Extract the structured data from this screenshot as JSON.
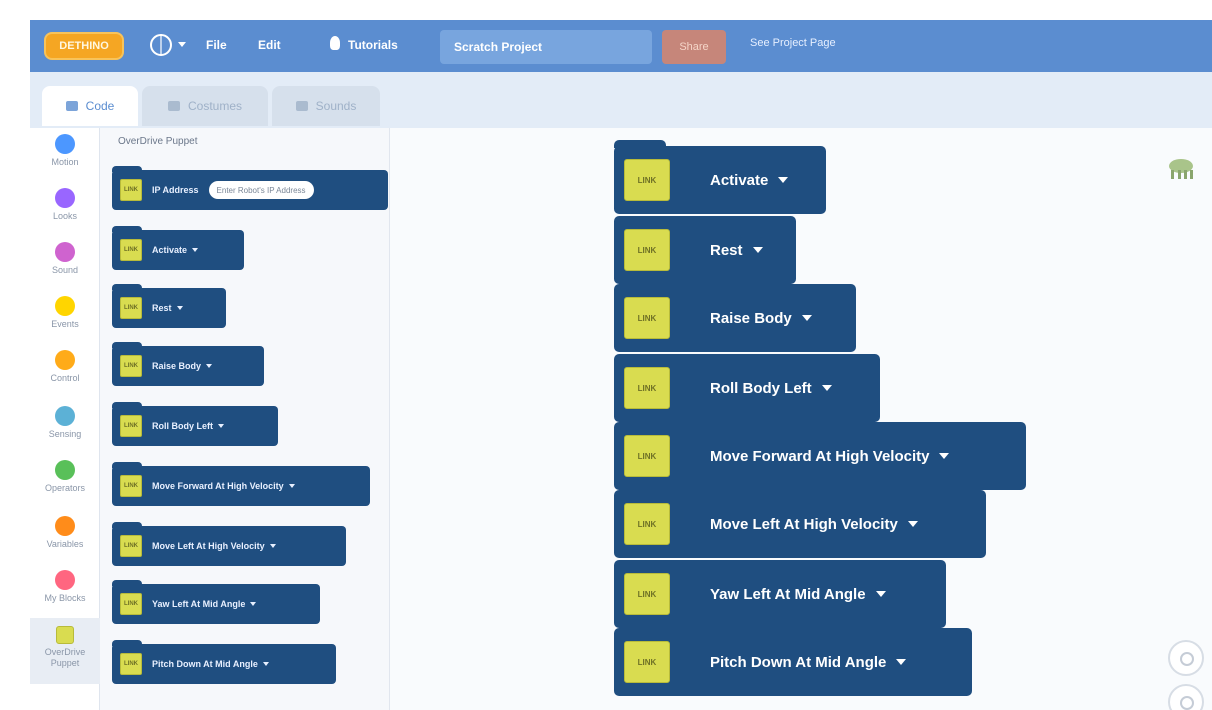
{
  "menubar": {
    "logo": "DETHINO",
    "file_label": "File",
    "edit_label": "Edit",
    "tutorials_label": "Tutorials",
    "project_title": "Scratch Project",
    "share_label": "Share",
    "see_project_label": "See Project Page"
  },
  "tabs": {
    "code": "Code",
    "costumes": "Costumes",
    "sounds": "Sounds"
  },
  "categories": [
    {
      "label": "Motion",
      "color": "#4c97ff"
    },
    {
      "label": "Looks",
      "color": "#9966ff"
    },
    {
      "label": "Sound",
      "color": "#cf63cf"
    },
    {
      "label": "Events",
      "color": "#ffd500"
    },
    {
      "label": "Control",
      "color": "#ffab19"
    },
    {
      "label": "Sensing",
      "color": "#5cb1d6"
    },
    {
      "label": "Operators",
      "color": "#59c059"
    },
    {
      "label": "Variables",
      "color": "#ff8c1a"
    },
    {
      "label": "My Blocks",
      "color": "#ff6680"
    },
    {
      "label": "OverDrive Puppet",
      "color": "#d9dc50"
    }
  ],
  "palette": {
    "title": "OverDrive Puppet",
    "block_icon_text": "LINK",
    "blocks": [
      {
        "label": "IP Address",
        "input_placeholder": "Enter Robot's IP Address"
      },
      {
        "label": "Activate"
      },
      {
        "label": "Rest"
      },
      {
        "label": "Raise Body"
      },
      {
        "label": "Roll Body Left"
      },
      {
        "label": "Move Forward At High Velocity"
      },
      {
        "label": "Move Left At High Velocity"
      },
      {
        "label": "Yaw Left At Mid Angle"
      },
      {
        "label": "Pitch Down At Mid Angle"
      }
    ]
  },
  "script": {
    "block_icon_text": "LINK",
    "blocks": [
      {
        "label": "Activate"
      },
      {
        "label": "Rest"
      },
      {
        "label": "Raise Body"
      },
      {
        "label": "Roll Body Left"
      },
      {
        "label": "Move Forward At High Velocity"
      },
      {
        "label": "Move Left At High Velocity"
      },
      {
        "label": "Yaw Left At Mid Angle"
      },
      {
        "label": "Pitch Down At Mid Angle"
      }
    ]
  }
}
